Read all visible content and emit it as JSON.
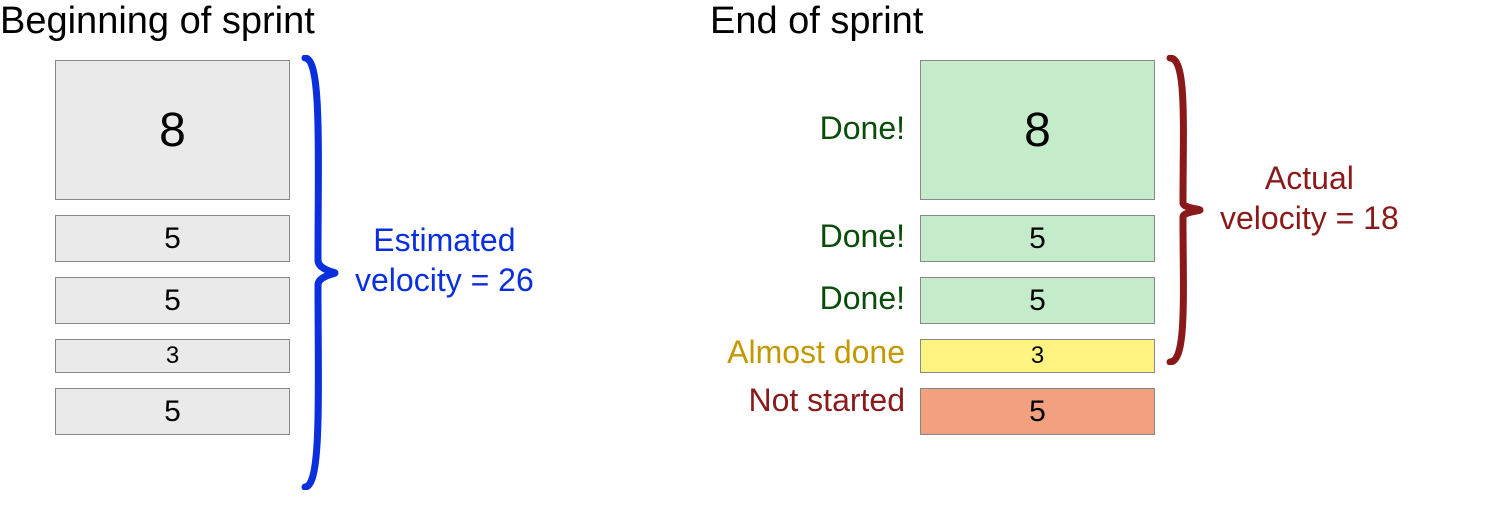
{
  "left": {
    "title": "Beginning of sprint",
    "cards": [
      "8",
      "5",
      "5",
      "3",
      "5"
    ],
    "velocity_line1": "Estimated",
    "velocity_line2": "velocity = 26"
  },
  "right": {
    "title": "End of sprint",
    "cards": [
      {
        "value": "8",
        "status": "Done!",
        "cls": "green",
        "statusCls": "done-color"
      },
      {
        "value": "5",
        "status": "Done!",
        "cls": "green",
        "statusCls": "done-color"
      },
      {
        "value": "5",
        "status": "Done!",
        "cls": "green",
        "statusCls": "done-color"
      },
      {
        "value": "3",
        "status": "Almost done",
        "cls": "yellow",
        "statusCls": "almost-color"
      },
      {
        "value": "5",
        "status": "Not started",
        "cls": "red",
        "statusCls": "not-color"
      }
    ],
    "velocity_line1": "Actual",
    "velocity_line2": "velocity = 18"
  }
}
